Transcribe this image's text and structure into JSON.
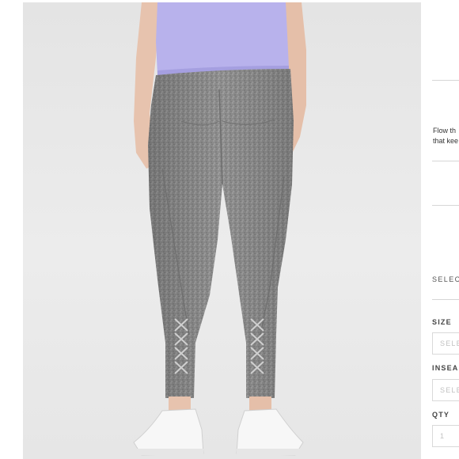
{
  "product": {
    "description_lines": [
      "Flow th",
      "that kee"
    ],
    "select_heading": "SELEC",
    "size": {
      "label": "SIZE",
      "placeholder": "SELE"
    },
    "inseam": {
      "label": "INSEA",
      "placeholder": "SELE"
    },
    "qty": {
      "label": "QTY",
      "value": "1"
    }
  },
  "colors": {
    "top": "#b8b2ec",
    "leggings": "#8f8f8f",
    "background": "#e8e8e8",
    "skin": "#e7c3ae"
  },
  "icons": [
    "sneaker-icon"
  ]
}
